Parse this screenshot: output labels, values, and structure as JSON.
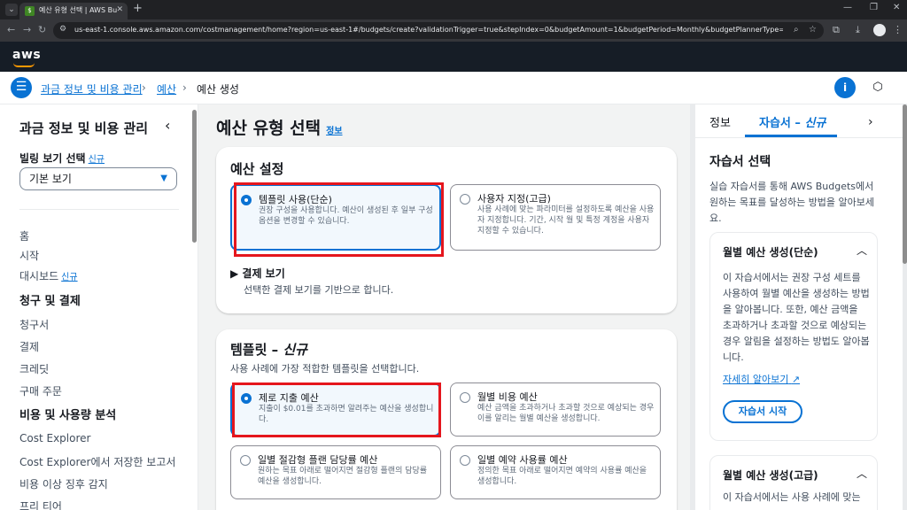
{
  "browser": {
    "tab_title": "예산 유형 선택 | AWS Budgets",
    "url": "us-east-1.console.aws.amazon.com/costmanagement/home?region=us-east-1#/budgets/create?validationTrigger=true&stepIndex=0&budgetAmount=1&budgetPeriod=Monthly&budgetPlannerType=FIXED&budgetType=COST&budget..."
  },
  "header": {
    "logo": "aws"
  },
  "breadcrumb": {
    "items": [
      "과금 정보 및 비용 관리",
      "예산",
      "예산 생성"
    ]
  },
  "nav": {
    "title": "과금 정보 및 비용 관리",
    "view_label": "빌링 보기 선택",
    "new_tag": "신규",
    "view_select_value": "기본 보기",
    "items": [
      {
        "label": "홈"
      },
      {
        "label": "시작"
      },
      {
        "label": "대시보드",
        "tag": "신규"
      }
    ],
    "section1": "청구 및 결제",
    "section1_items": [
      "청구서",
      "결제",
      "크레딧",
      "구매 주문"
    ],
    "section2": "비용 및 사용량 분석",
    "section2_items": [
      "Cost Explorer",
      "Cost Explorer에서 저장한 보고서",
      "비용 이상 징후 감지",
      "프리 티어"
    ]
  },
  "main": {
    "title": "예산 유형 선택",
    "info": "정보",
    "budget_settings": {
      "title": "예산 설정",
      "options": [
        {
          "title": "템플릿 사용(단순)",
          "desc": "권장 구성을 사용합니다. 예산이 생성된 후 일부 구성 옵션을 변경할 수 있습니다.",
          "selected": true
        },
        {
          "title": "사용자 지정(고급)",
          "desc": "사용 사례에 맞는 파라미터를 설정하도록 예산을 사용자 지정합니다. 기간, 시작 월 및 특정 계정을 사용자 지정할 수 있습니다.",
          "selected": false
        }
      ],
      "expander_title": "결제 보기",
      "expander_desc": "선택한 결제 보기를 기반으로 합니다."
    },
    "templates": {
      "title": "템플릿 –",
      "title_tag": "신규",
      "desc": "사용 사례에 가장 적합한 템플릿을 선택합니다.",
      "options": [
        {
          "title": "제로 지출 예산",
          "desc": "지출이 $0.01를 초과하면 알려주는 예산을 생성합니다.",
          "selected": true
        },
        {
          "title": "월별 비용 예산",
          "desc": "예산 금액을 초과하거나 초과할 것으로 예상되는 경우 이를 알리는 월별 예산을 생성합니다.",
          "selected": false
        },
        {
          "title": "일별 절감형 플랜 담당률 예산",
          "desc": "원하는 목표 아래로 떨어지면 절감형 플랜의 담당률 예산을 생성합니다.",
          "selected": false
        },
        {
          "title": "일별 예약 사용률 예산",
          "desc": "정의한 목표 아래로 떨어지면 예약의 사용률 예산을 생성합니다.",
          "selected": false
        }
      ]
    }
  },
  "help": {
    "tab_info": "정보",
    "tab_tutorial": "자습서 –",
    "tab_tutorial_tag": "신규",
    "heading": "자습서 선택",
    "intro": "실습 자습서를 통해 AWS Budgets에서 원하는 목표를 달성하는 방법을 알아보세요.",
    "card1": {
      "title": "월별 예산 생성(단순)",
      "body": "이 자습서에서는 권장 구성 세트를 사용하여 월별 예산을 생성하는 방법을 알아봅니다. 또한, 예산 금액을 초과하거나 초과할 것으로 예상되는 경우 알림을 설정하는 방법도 알아봅니다.",
      "link": "자세히 알아보기",
      "button": "자습서 시작"
    },
    "card2": {
      "title": "월별 예산 생성(고급)",
      "body": "이 자습서에서는 사용 사례에 맞는"
    }
  },
  "colors": {
    "accent": "#0972d3",
    "highlight_box": "#e5161d",
    "header_bg": "#161d26",
    "aws_orange": "#ff9900"
  }
}
